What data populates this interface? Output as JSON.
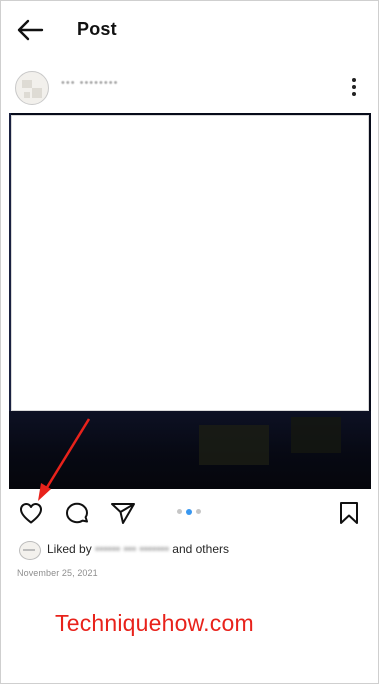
{
  "header": {
    "title": "Post"
  },
  "post": {
    "username": "••• ••••••••",
    "likes": {
      "prefix": "Liked by",
      "blurred_name": "•••••• ••• •••••••",
      "suffix": "and others"
    },
    "date": "November 25, 2021",
    "carousel": {
      "count": 3,
      "active": 1
    }
  },
  "icons": {
    "back": "arrow-left-icon",
    "more": "more-vertical-icon",
    "like": "heart-icon",
    "comment": "comment-bubble-icon",
    "share": "send-paper-plane-icon",
    "save": "bookmark-icon"
  },
  "colors": {
    "accent": "#3897f0",
    "annotation": "#e8221b"
  },
  "watermark": "Techniquehow.com"
}
